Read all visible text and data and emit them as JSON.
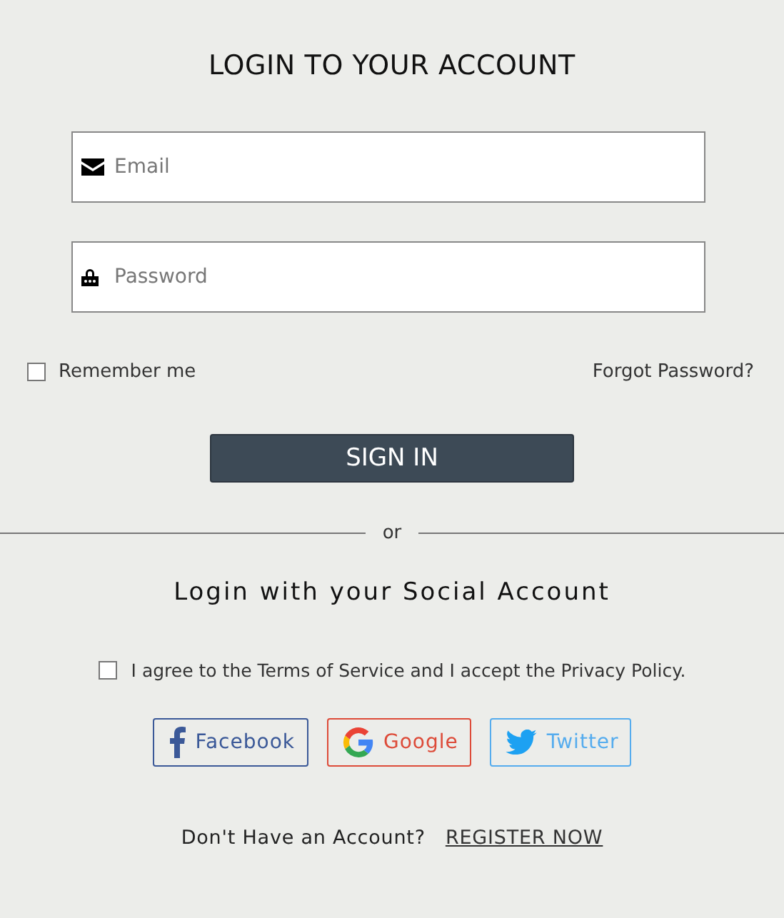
{
  "title": "LOGIN TO YOUR ACCOUNT",
  "fields": [
    {
      "kind": "email",
      "placeholder": "Email"
    },
    {
      "kind": "password",
      "placeholder": "Password"
    }
  ],
  "remember": {
    "label": "Remember me",
    "checked": false
  },
  "forgot_link": "Forgot Password?",
  "sign_in_button": "SIGN IN",
  "divider_text": "or",
  "social_heading": "Login with your Social Account",
  "agree": {
    "label": "I agree to the Terms of Service and I accept the Privacy Policy.",
    "checked": false
  },
  "social_buttons": [
    {
      "kind": "facebook",
      "label": "Facebook",
      "color": "#3b5998"
    },
    {
      "kind": "google",
      "label": "Google",
      "color": "#dd4b39"
    },
    {
      "kind": "twitter",
      "label": "Twitter",
      "color": "#55acee"
    }
  ],
  "register": {
    "prompt": "Don't Have an Account?",
    "link": "REGISTER NOW"
  }
}
